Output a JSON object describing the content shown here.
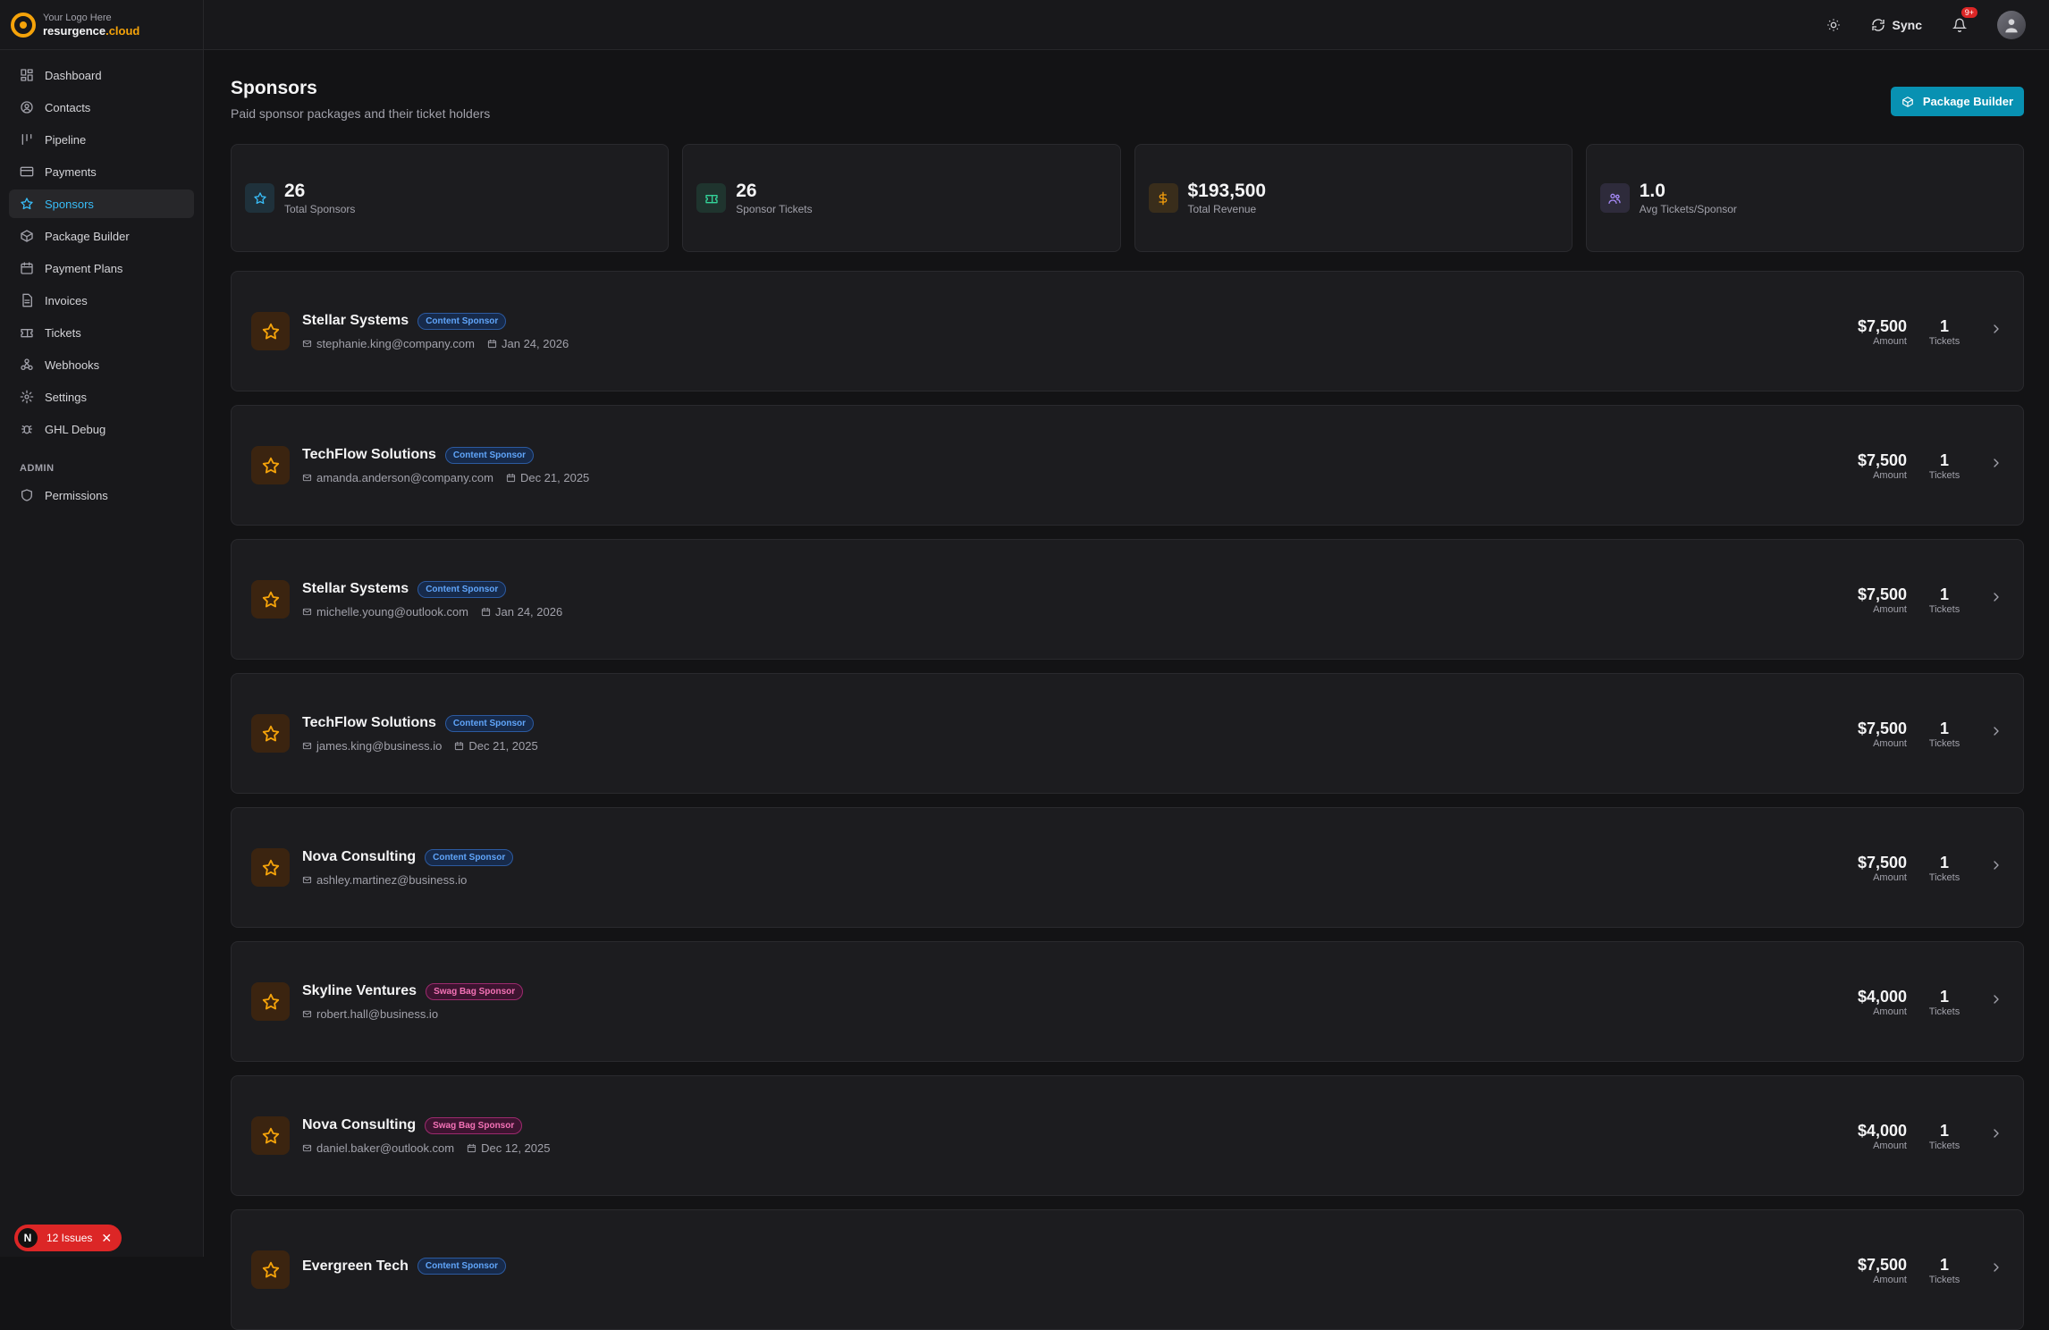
{
  "brand": {
    "tagline": "Your Logo Here",
    "name_main": "resurgence",
    "name_accent": ".cloud"
  },
  "sidebar": {
    "items": [
      {
        "label": "Dashboard",
        "icon": "dashboard-icon"
      },
      {
        "label": "Contacts",
        "icon": "contacts-icon"
      },
      {
        "label": "Pipeline",
        "icon": "pipeline-icon"
      },
      {
        "label": "Payments",
        "icon": "payments-icon"
      },
      {
        "label": "Sponsors",
        "icon": "star-icon",
        "active": true
      },
      {
        "label": "Package Builder",
        "icon": "package-icon"
      },
      {
        "label": "Payment Plans",
        "icon": "calendar-icon"
      },
      {
        "label": "Invoices",
        "icon": "invoice-icon"
      },
      {
        "label": "Tickets",
        "icon": "ticket-icon"
      },
      {
        "label": "Webhooks",
        "icon": "webhook-icon"
      },
      {
        "label": "Settings",
        "icon": "gear-icon"
      },
      {
        "label": "GHL Debug",
        "icon": "bug-icon"
      }
    ],
    "admin_section": "ADMIN",
    "admin_items": [
      {
        "label": "Permissions",
        "icon": "shield-icon"
      }
    ]
  },
  "issues": {
    "label": "12 Issues",
    "avatar_letter": "N"
  },
  "topbar": {
    "sync_label": "Sync",
    "notification_badge": "9+"
  },
  "page": {
    "title": "Sponsors",
    "subtitle": "Paid sponsor packages and their ticket holders",
    "package_builder_button": "Package Builder"
  },
  "stats": [
    {
      "value": "26",
      "label": "Total Sponsors",
      "icon": "star-icon",
      "color": "#38bdf8"
    },
    {
      "value": "26",
      "label": "Sponsor Tickets",
      "icon": "ticket-icon",
      "color": "#34d399"
    },
    {
      "value": "$193,500",
      "label": "Total Revenue",
      "icon": "dollar-icon",
      "color": "#f59e0b"
    },
    {
      "value": "1.0",
      "label": "Avg Tickets/Sponsor",
      "icon": "users-icon",
      "color": "#a78bfa"
    }
  ],
  "sponsors": [
    {
      "name": "Stellar Systems",
      "tag": "Content Sponsor",
      "tag_color": "blue",
      "email": "stephanie.king@company.com",
      "date": "Jan 24, 2026",
      "amount": "$7,500",
      "amount_label": "Amount",
      "tickets": "1",
      "tickets_label": "Tickets"
    },
    {
      "name": "TechFlow Solutions",
      "tag": "Content Sponsor",
      "tag_color": "blue",
      "email": "amanda.anderson@company.com",
      "date": "Dec 21, 2025",
      "amount": "$7,500",
      "amount_label": "Amount",
      "tickets": "1",
      "tickets_label": "Tickets"
    },
    {
      "name": "Stellar Systems",
      "tag": "Content Sponsor",
      "tag_color": "blue",
      "email": "michelle.young@outlook.com",
      "date": "Jan 24, 2026",
      "amount": "$7,500",
      "amount_label": "Amount",
      "tickets": "1",
      "tickets_label": "Tickets"
    },
    {
      "name": "TechFlow Solutions",
      "tag": "Content Sponsor",
      "tag_color": "blue",
      "email": "james.king@business.io",
      "date": "Dec 21, 2025",
      "amount": "$7,500",
      "amount_label": "Amount",
      "tickets": "1",
      "tickets_label": "Tickets"
    },
    {
      "name": "Nova Consulting",
      "tag": "Content Sponsor",
      "tag_color": "blue",
      "email": "ashley.martinez@business.io",
      "date": "",
      "amount": "$7,500",
      "amount_label": "Amount",
      "tickets": "1",
      "tickets_label": "Tickets"
    },
    {
      "name": "Skyline Ventures",
      "tag": "Swag Bag Sponsor",
      "tag_color": "pink",
      "email": "robert.hall@business.io",
      "date": "",
      "amount": "$4,000",
      "amount_label": "Amount",
      "tickets": "1",
      "tickets_label": "Tickets"
    },
    {
      "name": "Nova Consulting",
      "tag": "Swag Bag Sponsor",
      "tag_color": "pink",
      "email": "daniel.baker@outlook.com",
      "date": "Dec 12, 2025",
      "amount": "$4,000",
      "amount_label": "Amount",
      "tickets": "1",
      "tickets_label": "Tickets"
    },
    {
      "name": "Evergreen Tech",
      "tag": "Content Sponsor",
      "tag_color": "blue",
      "email": "",
      "date": "",
      "amount": "$7,500",
      "amount_label": "Amount",
      "tickets": "1",
      "tickets_label": "Tickets"
    }
  ]
}
